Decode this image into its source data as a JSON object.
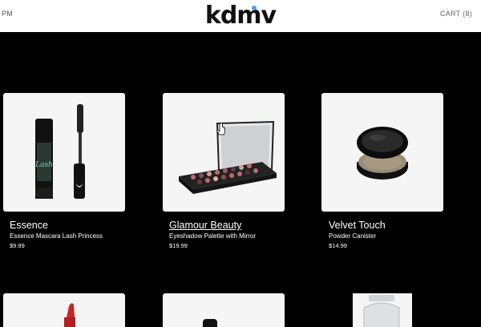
{
  "header": {
    "left_text": "PM",
    "logo": "kdmv",
    "cart_label": "CART (8)"
  },
  "products": [
    {
      "brand": "Essence",
      "name": "Essence Mascara Lash Princess",
      "price": "$9.99",
      "image_icon": "mascara-icon"
    },
    {
      "brand": "Glamour Beauty",
      "name": "Eyeshadow Palette with Mirror",
      "price": "$19.99",
      "image_icon": "eyeshadow-palette-icon"
    },
    {
      "brand": "Velvet Touch",
      "name": "Powder Canister",
      "price": "$14.99",
      "image_icon": "powder-canister-icon"
    }
  ],
  "next_row_images": [
    "lipstick-icon",
    "nail-polish-icon",
    "glass-bottle-icon"
  ],
  "colors": {
    "background": "#000000",
    "header": "#ffffff",
    "logo_dot": "#4aa3d8"
  }
}
